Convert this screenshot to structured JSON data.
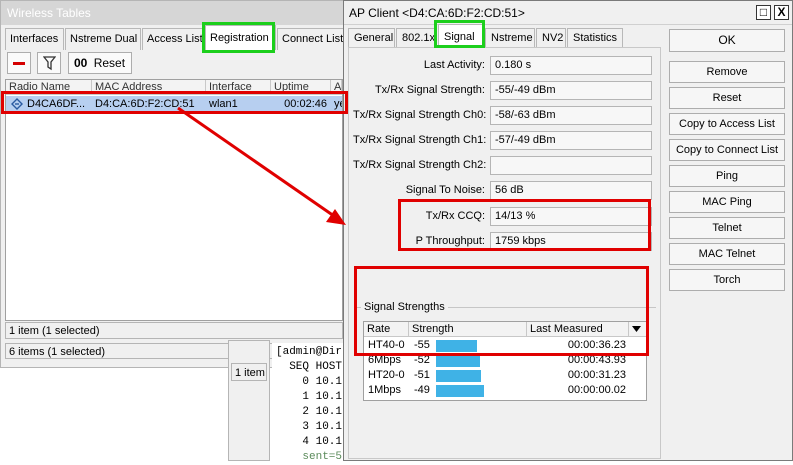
{
  "wireless_tables": {
    "title": "Wireless Tables",
    "tabs": [
      "Interfaces",
      "Nstreme Dual",
      "Access List",
      "Registration",
      "Connect List"
    ],
    "active_tab": "Registration",
    "toolbar": {
      "reset_prefix": "00",
      "reset_label": "Reset"
    },
    "columns": [
      "Radio Name",
      "MAC Address",
      "Interface",
      "Uptime",
      "AP"
    ],
    "row": {
      "radio_name": "D4CA6DF...",
      "mac_address": "D4:CA:6D:F2:CD:51",
      "interface": "wlan1",
      "uptime": "00:02:46",
      "ap": "ye"
    },
    "items_count": "1 item (1 selected)",
    "status": "6 items (1 selected)"
  },
  "background": {
    "small_panel_status": "1 item",
    "terminal_lines": [
      "[admin@Dir",
      "  SEQ HOST",
      "    0 10.1",
      "    1 10.1",
      "    2 10.1",
      "    3 10.1",
      "    4 10.1",
      "    sent=5"
    ]
  },
  "ap_client": {
    "title": "AP Client <D4:CA:6D:F2:CD:51>",
    "controls": {
      "maximize": "□",
      "close": "X"
    },
    "tabs": [
      "General",
      "802.1x",
      "Signal",
      "Nstreme",
      "NV2",
      "Statistics"
    ],
    "active_tab": "Signal",
    "fields": [
      {
        "label": "Last Activity:",
        "value": "0.180 s"
      },
      {
        "label": "Tx/Rx Signal Strength:",
        "value": "-55/-49 dBm"
      },
      {
        "label": "Tx/Rx Signal Strength Ch0:",
        "value": "-58/-63 dBm"
      },
      {
        "label": "Tx/Rx Signal Strength Ch1:",
        "value": "-57/-49 dBm"
      },
      {
        "label": "Tx/Rx Signal Strength Ch2:",
        "value": ""
      },
      {
        "label": "Signal To Noise:",
        "value": "56 dB"
      },
      {
        "label": "Tx/Rx CCQ:",
        "value": "14/13 %"
      },
      {
        "label": "P Throughput:",
        "value": "1759 kbps"
      }
    ],
    "signal_strengths": {
      "group_label": "Signal Strengths",
      "columns": [
        "Rate",
        "Strength",
        "Last Measured"
      ],
      "rows": [
        {
          "rate": "HT40-0",
          "strength": "-55",
          "bar": 0.78,
          "last": "00:00:36.23"
        },
        {
          "rate": "6Mbps",
          "strength": "-52",
          "bar": 0.85,
          "last": "00:00:43.93"
        },
        {
          "rate": "HT20-0",
          "strength": "-51",
          "bar": 0.87,
          "last": "00:00:31.23"
        },
        {
          "rate": "1Mbps",
          "strength": "-49",
          "bar": 0.93,
          "last": "00:00:00.02"
        }
      ]
    },
    "buttons": [
      "OK",
      "Remove",
      "Reset",
      "Copy to Access List",
      "Copy to Connect List",
      "Ping",
      "MAC Ping",
      "Telnet",
      "MAC Telnet",
      "Torch"
    ]
  },
  "colors": {
    "highlight_red": "#e00000",
    "highlight_green": "#1ccf1c",
    "selected_row": "#b7cff0",
    "signal_bar": "#3fb2e6"
  }
}
